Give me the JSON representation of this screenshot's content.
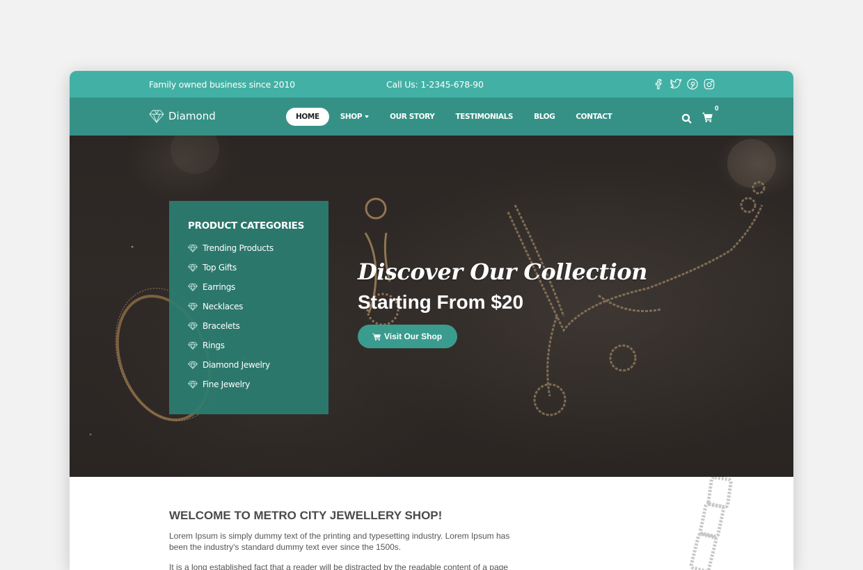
{
  "topbar": {
    "tagline": "Family owned business since 2010",
    "phone": "Call Us: 1-2345-678-90",
    "social": [
      "facebook-icon",
      "twitter-icon",
      "pinterest-icon",
      "instagram-icon"
    ]
  },
  "navbar": {
    "logo_text": "Diamond",
    "items": [
      {
        "label": "HOME",
        "active": true
      },
      {
        "label": "SHOP",
        "has_dropdown": true
      },
      {
        "label": "OUR STORY"
      },
      {
        "label": "TESTIMONIALS"
      },
      {
        "label": "BLOG"
      },
      {
        "label": "CONTACT"
      }
    ],
    "cart_count": "0"
  },
  "hero": {
    "categories_title": "PRODUCT CATEGORIES",
    "categories": [
      "Trending Products",
      "Top Gifts",
      "Earrings",
      "Necklaces",
      "Bracelets",
      "Rings",
      "Diamond Jewelry",
      "Fine Jewelry"
    ],
    "script_heading": "Discover Our Collection",
    "subheading": "Starting From $20",
    "cta_label": "Visit Our Shop"
  },
  "welcome": {
    "title": "WELCOME TO METRO CITY JEWELLERY SHOP!",
    "paragraph1": "Lorem Ipsum is simply dummy text of the printing and typesetting industry. Lorem Ipsum has been the industry's standard dummy text ever since the 1500s.",
    "paragraph2": "It is a long established fact that a reader will be distracted by the readable content of a page"
  },
  "colors": {
    "topbar": "#43b0a5",
    "navbar": "#359186",
    "panel": "#2b7e71",
    "button": "#3a9c8f"
  }
}
